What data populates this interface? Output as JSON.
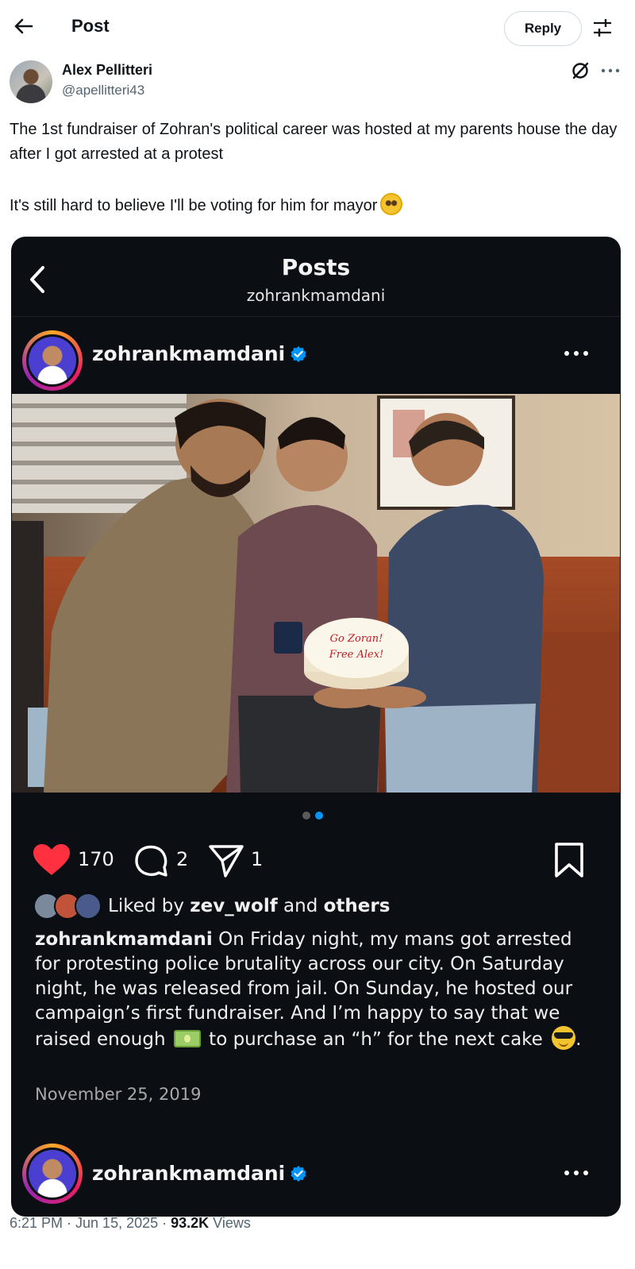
{
  "header": {
    "title": "Post",
    "reply_label": "Reply"
  },
  "author": {
    "name": "Alex Pellitteri",
    "handle": "@apellitteri43"
  },
  "tweet": {
    "line1": "The 1st fundraiser of Zohran's political career was hosted at my parents house the day after I got arrested at a protest",
    "line2": "It's still hard to believe I'll be voting for him for mayor"
  },
  "embed": {
    "title": "Posts",
    "subtitle": "zohrankmamdani",
    "username": "zohrankmamdani",
    "likes": "170",
    "comments": "2",
    "shares": "1",
    "liked_prefix": "Liked by",
    "liked_user": "zev_wolf",
    "liked_and": "and",
    "liked_others": "others",
    "caption_user": "zohrankmamdani",
    "caption_part1": " On Friday night, my mans got arrested for protesting police brutality across our city. On Saturday night, he was released from jail. On Sunday, he hosted our campaign’s first fundraiser. And I’m happy to say that we raised enough ",
    "caption_part2": " to purchase an “h” for the next cake ",
    "caption_end": ".",
    "date": "November 25, 2019",
    "cake_text": [
      "Go Zoran!",
      "Free Alex!"
    ],
    "carousel": {
      "count": 2,
      "active": 2
    }
  },
  "meta": {
    "time": "6:21 PM · Jun 15, 2025 · ",
    "views_count": "93.2K",
    "views_label": " Views"
  },
  "colors": {
    "heart": "#ff3040",
    "verified": "#0095f6",
    "card_bg": "#0b0e13"
  },
  "icons": [
    "back-arrow-icon",
    "tune-icon",
    "grok-icon",
    "more-icon",
    "chevron-left-icon",
    "verified-icon",
    "heart-icon",
    "comment-icon",
    "share-icon",
    "bookmark-icon"
  ]
}
